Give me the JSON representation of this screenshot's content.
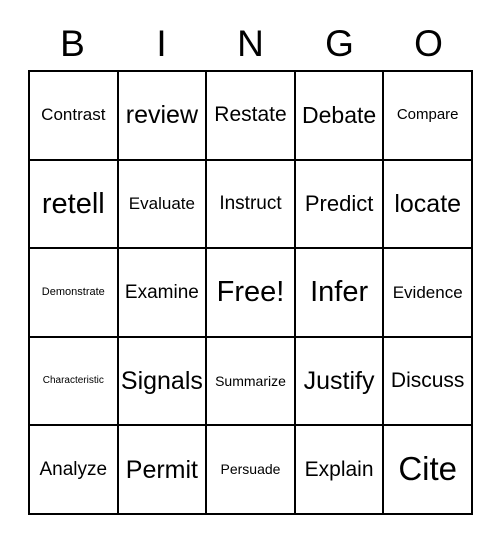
{
  "card": {
    "title": "BINGO Card",
    "background_color": "#ffffff",
    "line_color": "#000000",
    "text_color": "#000000"
  },
  "header": {
    "letters": [
      {
        "label": "B"
      },
      {
        "label": "I"
      },
      {
        "label": "N"
      },
      {
        "label": "G"
      },
      {
        "label": "O"
      }
    ]
  },
  "grid": {
    "rows": 5,
    "columns": 5,
    "free_space": {
      "row": 3,
      "column": 3,
      "label": "Free!"
    },
    "cells": [
      {
        "label": "Contrast",
        "font_size": "17px",
        "row": 1,
        "column": 1
      },
      {
        "label": "review",
        "font_size": "25px",
        "row": 1,
        "column": 2
      },
      {
        "label": "Restate",
        "font_size": "21px",
        "row": 1,
        "column": 3
      },
      {
        "label": "Debate",
        "font_size": "23px",
        "row": 1,
        "column": 4
      },
      {
        "label": "Compare",
        "font_size": "15px",
        "row": 1,
        "column": 5
      },
      {
        "label": "retell",
        "font_size": "29px",
        "row": 2,
        "column": 1
      },
      {
        "label": "Evaluate",
        "font_size": "17px",
        "row": 2,
        "column": 2
      },
      {
        "label": "Instruct",
        "font_size": "19px",
        "row": 2,
        "column": 3
      },
      {
        "label": "Predict",
        "font_size": "22px",
        "row": 2,
        "column": 4
      },
      {
        "label": "locate",
        "font_size": "25px",
        "row": 2,
        "column": 5
      },
      {
        "label": "Demonstrate",
        "font_size": "11px",
        "row": 3,
        "column": 1
      },
      {
        "label": "Examine",
        "font_size": "19px",
        "row": 3,
        "column": 2
      },
      {
        "label": "Free!",
        "font_size": "29px",
        "row": 3,
        "column": 3
      },
      {
        "label": "Infer",
        "font_size": "29px",
        "row": 3,
        "column": 4
      },
      {
        "label": "Evidence",
        "font_size": "17px",
        "row": 3,
        "column": 5
      },
      {
        "label": "Characteristic",
        "font_size": "10px",
        "row": 4,
        "column": 1
      },
      {
        "label": "Signals",
        "font_size": "25px",
        "row": 4,
        "column": 2
      },
      {
        "label": "Summarize",
        "font_size": "14px",
        "row": 4,
        "column": 3
      },
      {
        "label": "Justify",
        "font_size": "25px",
        "row": 4,
        "column": 4
      },
      {
        "label": "Discuss",
        "font_size": "21px",
        "row": 4,
        "column": 5
      },
      {
        "label": "Analyze",
        "font_size": "19px",
        "row": 5,
        "column": 1
      },
      {
        "label": "Permit",
        "font_size": "25px",
        "row": 5,
        "column": 2
      },
      {
        "label": "Persuade",
        "font_size": "14px",
        "row": 5,
        "column": 3
      },
      {
        "label": "Explain",
        "font_size": "21px",
        "row": 5,
        "column": 4
      },
      {
        "label": "Cite",
        "font_size": "33px",
        "row": 5,
        "column": 5
      }
    ]
  }
}
